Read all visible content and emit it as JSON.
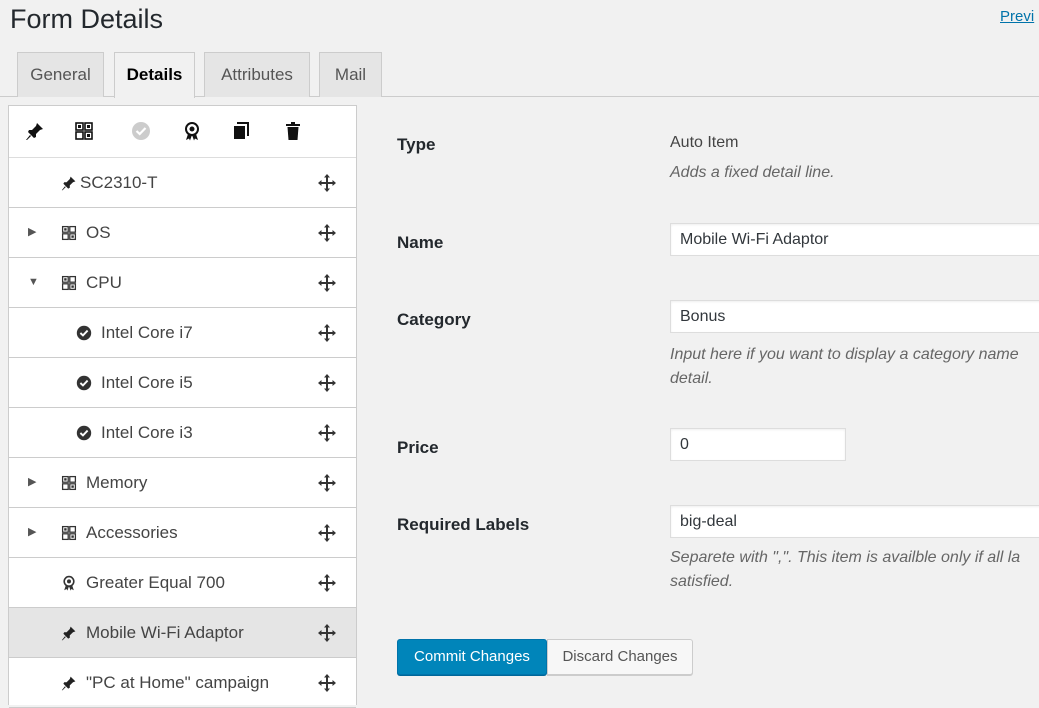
{
  "header": {
    "title": "Form Details",
    "preview_link": "Previ"
  },
  "tabs": [
    {
      "label": "General"
    },
    {
      "label": "Details"
    },
    {
      "label": "Attributes"
    },
    {
      "label": "Mail"
    }
  ],
  "toolbar": {
    "icons": [
      "pin-icon",
      "qr-grid-icon",
      "check-circle-icon",
      "award-icon",
      "copy-icon",
      "trash-icon"
    ]
  },
  "list": {
    "items": [
      {
        "label": "SC2310-T",
        "icon": "pin-icon"
      },
      {
        "label": "OS",
        "icon": "qr-grid-icon",
        "expander": "collapsed"
      },
      {
        "label": "CPU",
        "icon": "qr-grid-icon",
        "expander": "expanded"
      },
      {
        "label": "Intel Core i7",
        "icon": "check-circle-icon"
      },
      {
        "label": "Intel Core i5",
        "icon": "check-circle-icon"
      },
      {
        "label": "Intel Core i3",
        "icon": "check-circle-icon"
      },
      {
        "label": "Memory",
        "icon": "qr-grid-icon",
        "expander": "collapsed"
      },
      {
        "label": "Accessories",
        "icon": "qr-grid-icon",
        "expander": "collapsed"
      },
      {
        "label": "Greater Equal 700",
        "icon": "award-icon"
      },
      {
        "label": "Mobile Wi-Fi Adaptor",
        "icon": "pin-icon",
        "selected": true
      },
      {
        "label": "\"PC at Home\" campaign",
        "icon": "pin-icon"
      }
    ]
  },
  "form": {
    "type_label": "Type",
    "type_value": "Auto Item",
    "type_desc": "Adds a fixed detail line.",
    "name_label": "Name",
    "name_value": "Mobile Wi-Fi Adaptor",
    "category_label": "Category",
    "category_value": "Bonus",
    "category_desc_1": "Input here if you want to display a category name",
    "category_desc_2": "detail.",
    "price_label": "Price",
    "price_value": "0",
    "labels_label": "Required Labels",
    "labels_value": "big-deal",
    "labels_desc_1": "Separete with \",\". This item is availble only if all la",
    "labels_desc_2": "satisfied.",
    "commit_label": "Commit Changes",
    "discard_label": "Discard Changes"
  },
  "colors": {
    "primary": "#0085ba",
    "link": "#0073aa",
    "selected_row": "#e5e5e5"
  }
}
